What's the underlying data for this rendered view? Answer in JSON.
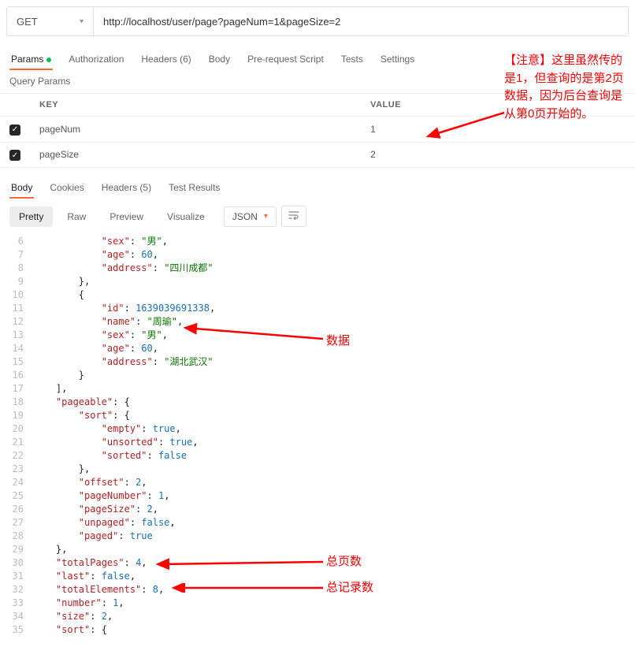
{
  "request": {
    "method": "GET",
    "url": "http://localhost/user/page?pageNum=1&pageSize=2"
  },
  "reqTabs": {
    "params": "Params",
    "auth": "Authorization",
    "headers": "Headers (6)",
    "body": "Body",
    "pre": "Pre-request Script",
    "tests": "Tests",
    "settings": "Settings"
  },
  "queryParams": {
    "title": "Query Params",
    "keyHeader": "KEY",
    "valueHeader": "VALUE",
    "rows": [
      {
        "key": "pageNum",
        "value": "1"
      },
      {
        "key": "pageSize",
        "value": "2"
      }
    ]
  },
  "respTabs": {
    "body": "Body",
    "cookies": "Cookies",
    "headers": "Headers (5)",
    "tests": "Test Results"
  },
  "toolbar": {
    "pretty": "Pretty",
    "raw": "Raw",
    "preview": "Preview",
    "visualize": "Visualize",
    "format": "JSON"
  },
  "code": {
    "l6": "            \"sex\": \"男\",",
    "l7": "            \"age\": 60,",
    "l8": "            \"address\": \"四川成都\"",
    "l9": "        },",
    "l10": "        {",
    "l11": "            \"id\": 1639039691338,",
    "l12": "            \"name\": \"周瑜\",",
    "l13": "            \"sex\": \"男\",",
    "l14": "            \"age\": 60,",
    "l15": "            \"address\": \"湖北武汉\"",
    "l16": "        }",
    "l17": "    ],",
    "l18": "    \"pageable\": {",
    "l19": "        \"sort\": {",
    "l20": "            \"empty\": true,",
    "l21": "            \"unsorted\": true,",
    "l22": "            \"sorted\": false",
    "l23": "        },",
    "l24": "        \"offset\": 2,",
    "l25": "        \"pageNumber\": 1,",
    "l26": "        \"pageSize\": 2,",
    "l27": "        \"unpaged\": false,",
    "l28": "        \"paged\": true",
    "l29": "    },",
    "l30": "    \"totalPages\": 4,",
    "l31": "    \"last\": false,",
    "l32": "    \"totalElements\": 8,",
    "l33": "    \"number\": 1,",
    "l34": "    \"size\": 2,",
    "l35": "    \"sort\": {"
  },
  "gutter": {
    "g6": "6",
    "g7": "7",
    "g8": "8",
    "g9": "9",
    "g10": "10",
    "g11": "11",
    "g12": "12",
    "g13": "13",
    "g14": "14",
    "g15": "15",
    "g16": "16",
    "g17": "17",
    "g18": "18",
    "g19": "19",
    "g20": "20",
    "g21": "21",
    "g22": "22",
    "g23": "23",
    "g24": "24",
    "g25": "25",
    "g26": "26",
    "g27": "27",
    "g28": "28",
    "g29": "29",
    "g30": "30",
    "g31": "31",
    "g32": "32",
    "g33": "33",
    "g34": "34",
    "g35": "35"
  },
  "annotations": {
    "note1": "【注意】这里虽然传的是1，但查询的是第2页数据，因为后台查询是从第0页开始的。",
    "note2": "数据",
    "note3": "总页数",
    "note4": "总记录数"
  }
}
